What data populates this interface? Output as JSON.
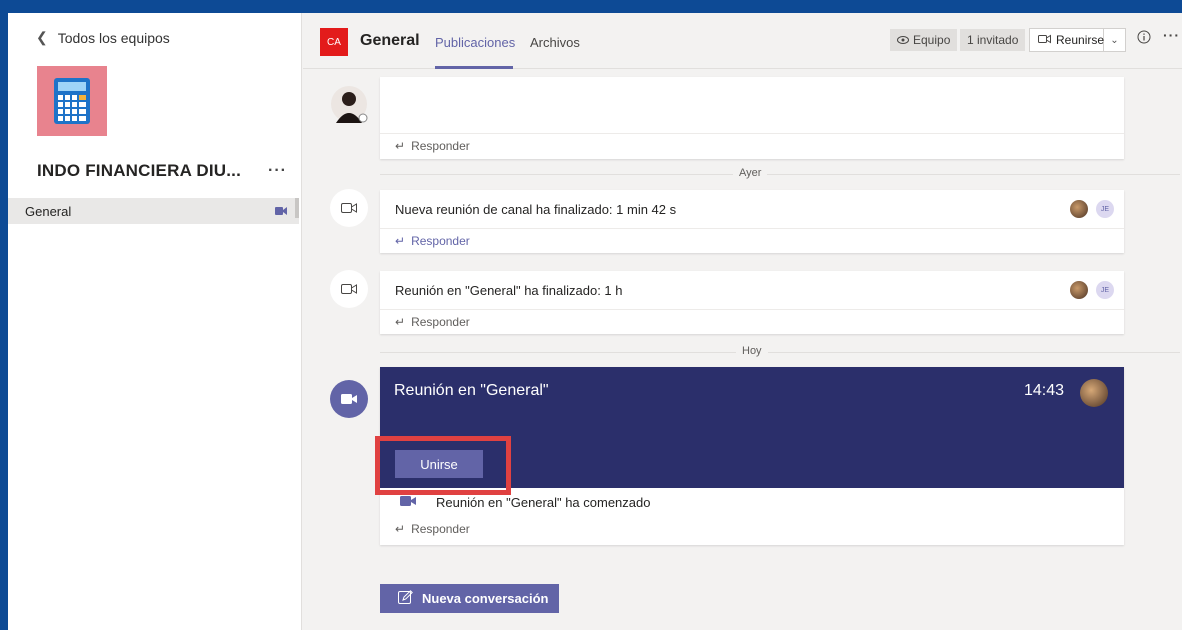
{
  "sidebar": {
    "back_label": "Todos los equipos",
    "team_name": "INDO FINANCIERA DIU...",
    "more": "···",
    "channels": [
      {
        "label": "General"
      }
    ]
  },
  "header": {
    "channel_avatar": "CA",
    "channel_name": "General",
    "tabs": [
      {
        "label": "Publicaciones",
        "active": true
      },
      {
        "label": "Archivos",
        "active": false
      }
    ],
    "team_label": "Equipo",
    "guests_label": "1 invitado",
    "meet_label": "Reunirse",
    "info_icon": "info-icon",
    "more": "···"
  },
  "feed": {
    "day_yesterday": "Ayer",
    "day_today": "Hoy",
    "messages": [
      {
        "text": "",
        "reply": "Responder"
      },
      {
        "text": "Nueva reunión de canal ha finalizado: 1 min 42 s",
        "reply": "Responder",
        "participant_initials": "JE"
      },
      {
        "text": "Reunión en \"General\" ha finalizado: 1 h",
        "reply": "Responder",
        "participant_initials": "JE"
      }
    ],
    "meeting": {
      "title": "Reunión en \"General\"",
      "time": "14:43",
      "join_label": "Unirse",
      "started_text": "Reunión en \"General\" ha comenzado",
      "reply": "Responder"
    }
  },
  "compose": {
    "new_conversation_label": "Nueva conversación"
  },
  "colors": {
    "accent": "#6264a7",
    "meeting_banner": "#2b2f6b",
    "highlight": "#e04141",
    "desktop": "#0d4a95"
  }
}
